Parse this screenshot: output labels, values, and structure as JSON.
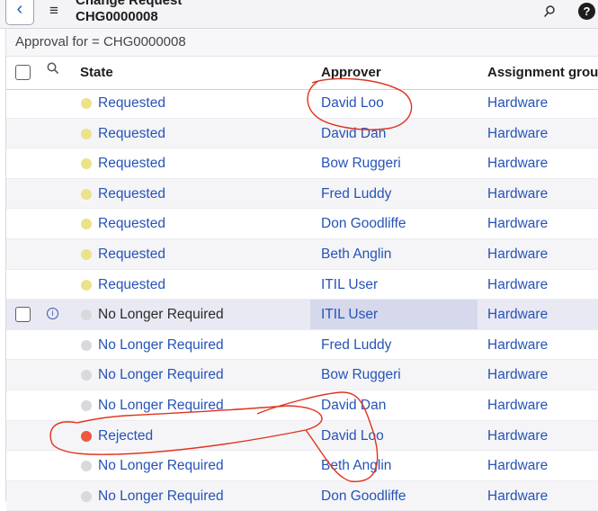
{
  "header": {
    "title": "Change Request",
    "subtitle": "CHG0000008",
    "back_icon": "‹",
    "menu_icon": "≡",
    "attach_icon": "⚲",
    "help_icon": "?"
  },
  "filter": {
    "text": "Approval for = CHG0000008"
  },
  "columns": {
    "state": "State",
    "approver": "Approver",
    "group": "Assignment group"
  },
  "colors": {
    "requested": "#ece28a",
    "no_longer": "#d9d9dd",
    "rejected": "#f0573d",
    "link": "#2653b8",
    "annotation": "#e0321e"
  },
  "rows": [
    {
      "state": "Requested",
      "state_type": "requested",
      "approver": "David Loo",
      "group": "Hardware"
    },
    {
      "state": "Requested",
      "state_type": "requested",
      "approver": "David Dan",
      "group": "Hardware"
    },
    {
      "state": "Requested",
      "state_type": "requested",
      "approver": "Bow Ruggeri",
      "group": "Hardware"
    },
    {
      "state": "Requested",
      "state_type": "requested",
      "approver": "Fred Luddy",
      "group": "Hardware"
    },
    {
      "state": "Requested",
      "state_type": "requested",
      "approver": "Don Goodliffe",
      "group": "Hardware"
    },
    {
      "state": "Requested",
      "state_type": "requested",
      "approver": "Beth Anglin",
      "group": "Hardware"
    },
    {
      "state": "Requested",
      "state_type": "requested",
      "approver": "ITIL User",
      "group": "Hardware"
    },
    {
      "state": "No Longer Required",
      "state_type": "no_longer",
      "approver": "ITIL User",
      "group": "Hardware"
    },
    {
      "state": "No Longer Required",
      "state_type": "no_longer",
      "approver": "Fred Luddy",
      "group": "Hardware"
    },
    {
      "state": "No Longer Required",
      "state_type": "no_longer",
      "approver": "Bow Ruggeri",
      "group": "Hardware"
    },
    {
      "state": "No Longer Required",
      "state_type": "no_longer",
      "approver": "David Dan",
      "group": "Hardware"
    },
    {
      "state": "Rejected",
      "state_type": "rejected",
      "approver": "David Loo",
      "group": "Hardware"
    },
    {
      "state": "No Longer Required",
      "state_type": "no_longer",
      "approver": "Beth Anglin",
      "group": "Hardware"
    },
    {
      "state": "No Longer Required",
      "state_type": "no_longer",
      "approver": "Don Goodliffe",
      "group": "Hardware"
    }
  ],
  "highlighted_row": 7
}
